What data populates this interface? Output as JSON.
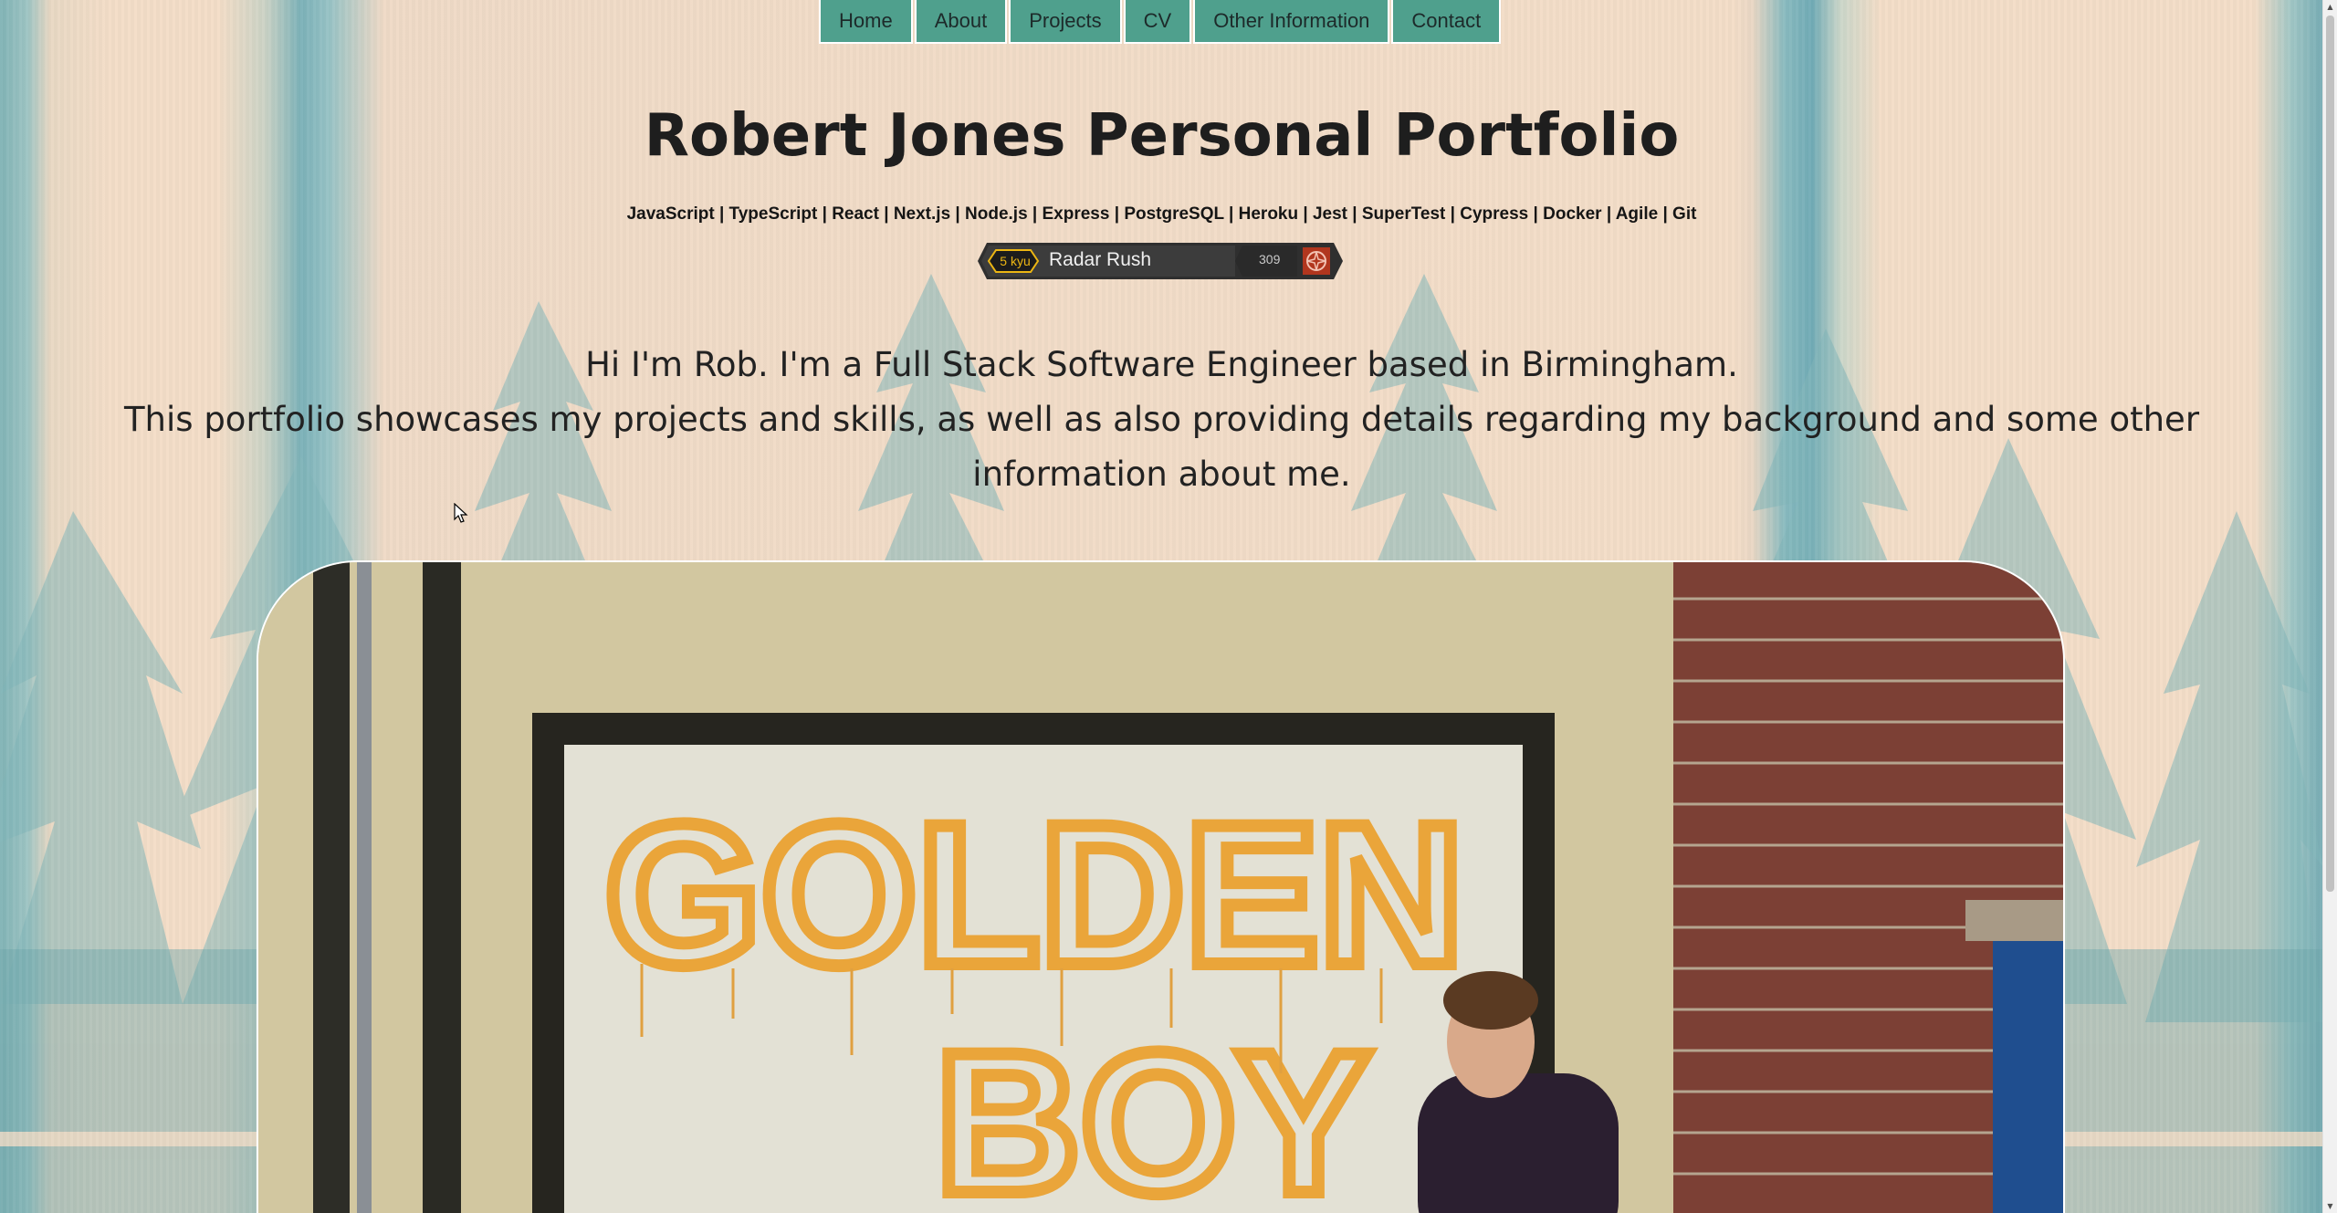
{
  "nav": {
    "items": [
      {
        "label": "Home"
      },
      {
        "label": "About"
      },
      {
        "label": "Projects"
      },
      {
        "label": "CV"
      },
      {
        "label": "Other Information"
      },
      {
        "label": "Contact"
      }
    ]
  },
  "header": {
    "title": "Robert Jones Personal Portfolio",
    "skills": "JavaScript | TypeScript | React | Next.js | Node.js | Express | PostgreSQL | Heroku | Jest | SuperTest | Cypress | Docker | Agile | Git"
  },
  "codewars_badge": {
    "rank": "5 kyu",
    "username": "Radar Rush",
    "honor": "309",
    "icon": "codewars-logo-icon"
  },
  "intro": {
    "line1": "Hi I'm Rob. I'm a Full Stack Software Engineer based in Birmingham.",
    "line2": "This portfolio showcases my projects and skills, as well as also providing details regarding my background and some other information about me."
  },
  "photo": {
    "mural_line1": "GOLDEN",
    "mural_line2": "BOY"
  },
  "colors": {
    "nav_bg": "#4fa08d",
    "page_bg": "#f3dcc6",
    "badge_bg": "#3b3b3b",
    "rank_color": "#ecb613",
    "mural_paint": "#eaa53a"
  }
}
